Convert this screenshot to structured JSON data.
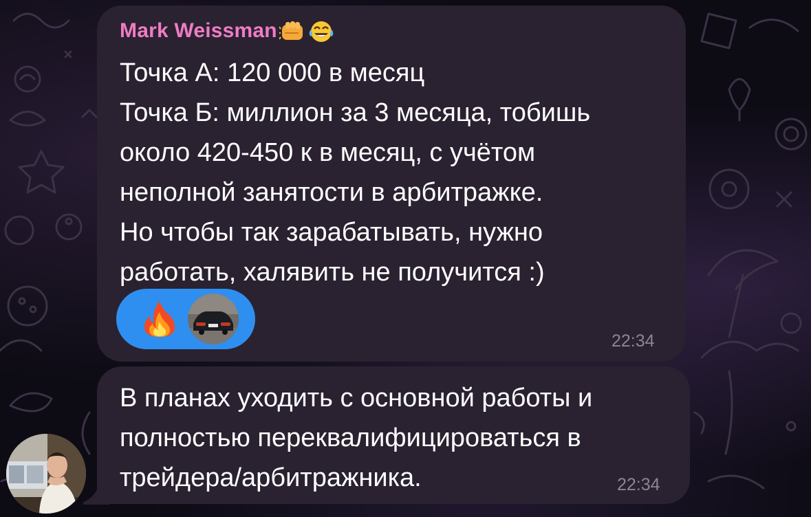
{
  "theme": {
    "bubble_color": "#2a2230",
    "sender_name_color": "#ef7cc4",
    "reaction_color": "#2f8ff0",
    "time_color": "#8e8494",
    "text_color": "#ffffff"
  },
  "messages": [
    {
      "sender": "Mark Weissman",
      "status_icons": [
        "fist-bump-emoji-icon",
        "tears-of-joy-emoji-icon"
      ],
      "lines": [
        "Точка А: 120 000 в месяц",
        "Точка Б: миллион за 3 месяца, тобишь",
        "около 420-450 к в месяц, с учётом",
        "неполной занятости в арбитражке.",
        "Но чтобы так зарабатывать, нужно",
        "работать, халявить не получится :)"
      ],
      "reaction": {
        "emoji": "🔥",
        "icon": "fire-icon",
        "reactor": "reactor-avatar"
      },
      "time": "22:34"
    },
    {
      "lines": [
        "В планах уходить с основной работы и",
        "полностью переквалифицироваться в",
        "трейдера/арбитражника."
      ],
      "time": "22:34"
    }
  ]
}
